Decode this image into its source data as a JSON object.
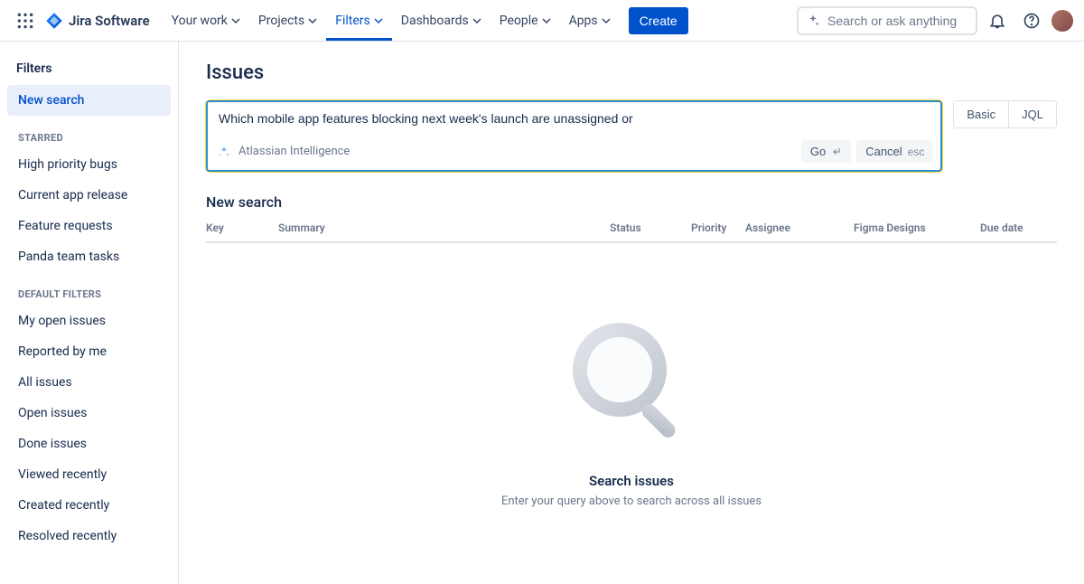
{
  "nav": {
    "product_name": "Jira Software",
    "items": [
      {
        "label": "Your work"
      },
      {
        "label": "Projects"
      },
      {
        "label": "Filters"
      },
      {
        "label": "Dashboards"
      },
      {
        "label": "People"
      },
      {
        "label": "Apps"
      }
    ],
    "create_label": "Create",
    "search_placeholder": "Search or ask anything"
  },
  "sidebar": {
    "title": "Filters",
    "new_search": "New search",
    "starred_heading": "STARRED",
    "starred": [
      "High priority bugs",
      "Current app release",
      "Feature requests",
      "Panda team tasks"
    ],
    "default_heading": "DEFAULT FILTERS",
    "defaults": [
      "My open issues",
      "Reported by me",
      "All issues",
      "Open issues",
      "Done issues",
      "Viewed recently",
      "Created recently",
      "Resolved recently"
    ]
  },
  "page": {
    "title": "Issues",
    "query": "Which mobile app features blocking next week's launch are unassigned or",
    "ai_label": "Atlassian Intelligence",
    "go_label": "Go",
    "cancel_label": "Cancel",
    "cancel_kbd": "esc",
    "toggle_basic": "Basic",
    "toggle_jql": "JQL",
    "subheader": "New search",
    "columns": {
      "key": "Key",
      "summary": "Summary",
      "status": "Status",
      "priority": "Priority",
      "assignee": "Assignee",
      "figma": "Figma Designs",
      "due": "Due date"
    },
    "empty_title": "Search issues",
    "empty_sub": "Enter your query above to search across all issues"
  }
}
